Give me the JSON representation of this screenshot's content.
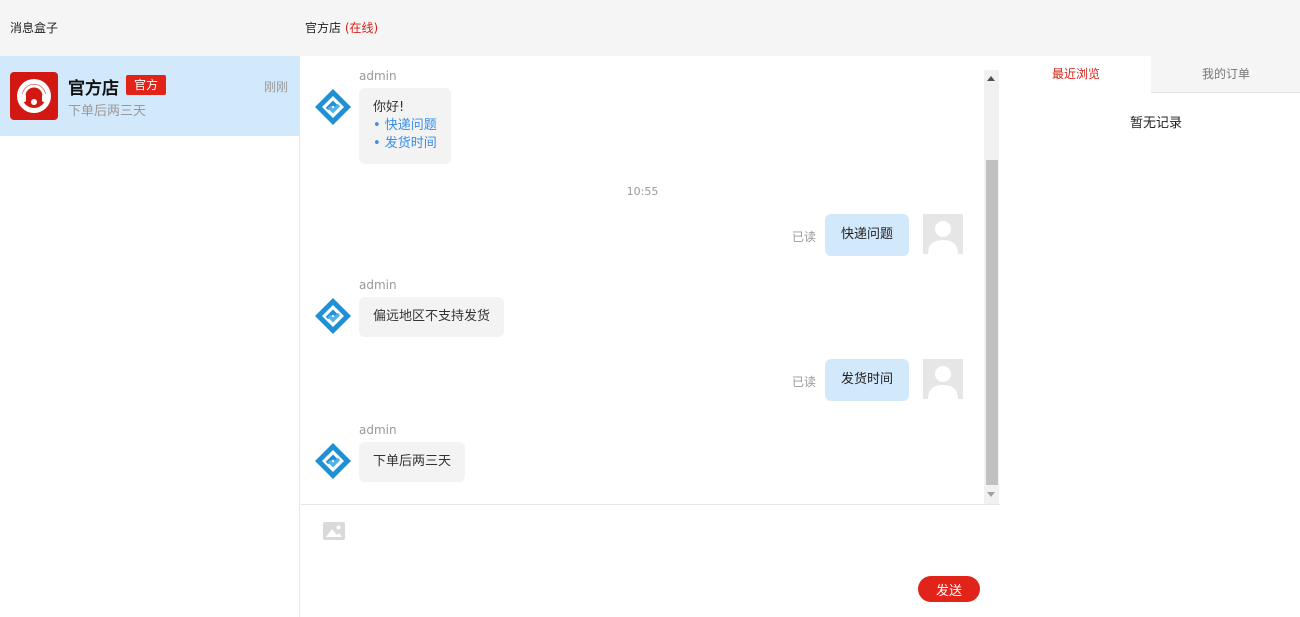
{
  "header": {
    "box_title": "消息盒子",
    "chat_title": "官方店",
    "chat_status": "(在线)"
  },
  "conversations": [
    {
      "name": "官方店",
      "badge": "官方",
      "preview": "下单后两三天",
      "time": "刚刚"
    }
  ],
  "messages": {
    "m1": {
      "sender": "admin",
      "greeting": "你好!",
      "options": [
        "• 快递问题",
        "• 发货时间"
      ]
    },
    "timestamp": "10:55",
    "m2": {
      "text": "快递问题",
      "status": "已读"
    },
    "m3": {
      "sender": "admin",
      "text": "偏远地区不支持发货"
    },
    "m4": {
      "text": "发货时间",
      "status": "已读"
    },
    "m5": {
      "sender": "admin",
      "text": "下单后两三天"
    }
  },
  "composer": {
    "send_label": "发送"
  },
  "sidebar": {
    "tabs": [
      "最近浏览",
      "我的订单"
    ],
    "empty_text": "暂无记录"
  },
  "colors": {
    "accent": "#e2231a",
    "selected_bg": "#d2e8fb",
    "link": "#3a8ee6"
  }
}
